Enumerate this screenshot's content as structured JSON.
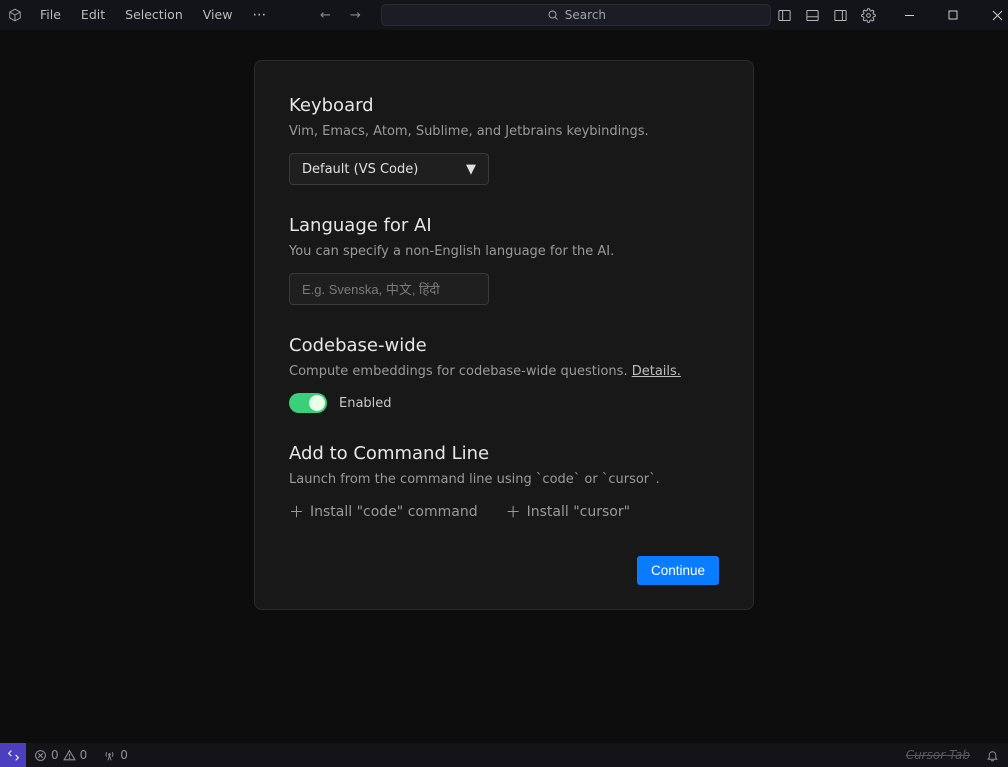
{
  "menu": {
    "file": "File",
    "edit": "Edit",
    "selection": "Selection",
    "view": "View",
    "more": "⋯"
  },
  "nav": {
    "back": "←",
    "forward": "→"
  },
  "search": {
    "placeholder": "Search"
  },
  "sections": {
    "keyboard": {
      "title": "Keyboard",
      "desc": "Vim, Emacs, Atom, Sublime, and Jetbrains keybindings.",
      "selected": "Default (VS Code)"
    },
    "language": {
      "title": "Language for AI",
      "desc": "You can specify a non-English language for the AI.",
      "placeholder": "E.g. Svenska, 中文, हिंदी"
    },
    "codebase": {
      "title": "Codebase-wide",
      "desc_prefix": "Compute embeddings for codebase-wide questions. ",
      "details_label": "Details.",
      "toggle_label": "Enabled"
    },
    "cli": {
      "title": "Add to Command Line",
      "desc": "Launch from the command line using `code` or `cursor`.",
      "install_code": "Install \"code\" command",
      "install_cursor": "Install \"cursor\""
    }
  },
  "actions": {
    "continue": "Continue"
  },
  "status": {
    "errors": "0",
    "warnings": "0",
    "ports": "0",
    "cursor_tab": "Cursor Tab"
  }
}
